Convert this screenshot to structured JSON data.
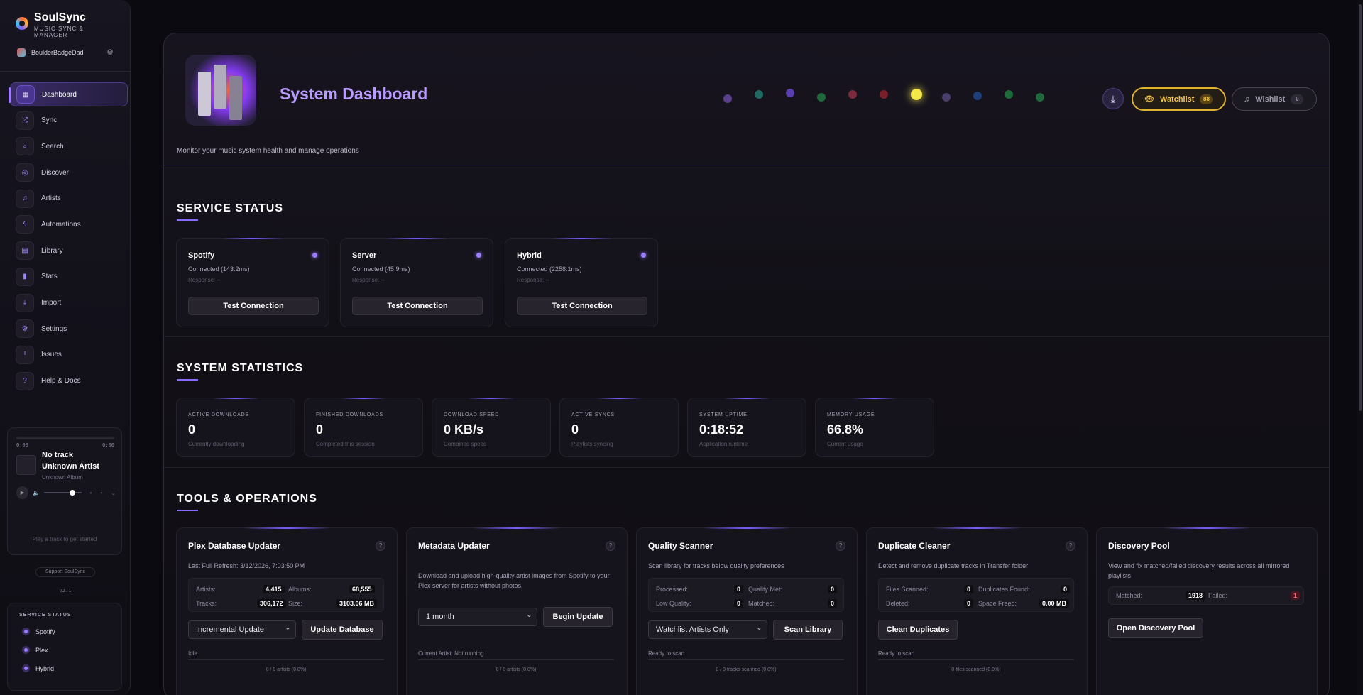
{
  "app": {
    "name": "SoulSync",
    "subtitle": "MUSIC SYNC & MANAGER",
    "user": "BoulderBadgeDad"
  },
  "nav": [
    {
      "label": "Dashboard",
      "icon": "grid-icon",
      "active": true
    },
    {
      "label": "Sync",
      "icon": "shuffle-icon"
    },
    {
      "label": "Search",
      "icon": "search-icon"
    },
    {
      "label": "Discover",
      "icon": "compass-icon"
    },
    {
      "label": "Artists",
      "icon": "music-note-icon"
    },
    {
      "label": "Automations",
      "icon": "bolt-icon"
    },
    {
      "label": "Library",
      "icon": "book-icon"
    },
    {
      "label": "Stats",
      "icon": "bar-chart-icon"
    },
    {
      "label": "Import",
      "icon": "import-icon"
    },
    {
      "label": "Settings",
      "icon": "gear-icon"
    },
    {
      "label": "Issues",
      "icon": "alert-icon"
    },
    {
      "label": "Help & Docs",
      "icon": "help-icon"
    }
  ],
  "player": {
    "time_start": "0:00",
    "time_end": "0:00",
    "title": "No track",
    "artist": "Unknown Artist",
    "album": "Unknown Album",
    "hint": "Play a track to get started"
  },
  "support": "Support SoulSync",
  "version": "v2.1",
  "sidebar_status": {
    "title": "SERVICE STATUS",
    "items": [
      "Spotify",
      "Plex",
      "Hybrid"
    ]
  },
  "header": {
    "title": "System Dashboard",
    "subtitle": "Monitor your music system health and manage operations",
    "watchlist_label": "Watchlist",
    "watchlist_count": "88",
    "wishlist_label": "Wishlist",
    "wishlist_count": "0"
  },
  "led_colors": [
    "#5a3f8c",
    "#1f6b63",
    "#5a3fb0",
    "#1f6a3a",
    "#7a2a3a",
    "#7a1f2a",
    "#f2e84a",
    "#4a3f6a",
    "#1f3f7a",
    "#1f6a3a",
    "#1f6a3a"
  ],
  "service_status": {
    "title": "SERVICE STATUS",
    "cards": [
      {
        "name": "Spotify",
        "connection": "Connected (143.2ms)",
        "response": "Response: --",
        "button": "Test Connection"
      },
      {
        "name": "Server",
        "connection": "Connected (45.9ms)",
        "response": "Response: --",
        "button": "Test Connection"
      },
      {
        "name": "Hybrid",
        "connection": "Connected (2258.1ms)",
        "response": "Response: --",
        "button": "Test Connection"
      }
    ]
  },
  "system_statistics": {
    "title": "SYSTEM STATISTICS",
    "cards": [
      {
        "label": "ACTIVE DOWNLOADS",
        "value": "0",
        "sub": "Currently downloading"
      },
      {
        "label": "FINISHED DOWNLOADS",
        "value": "0",
        "sub": "Completed this session"
      },
      {
        "label": "DOWNLOAD SPEED",
        "value": "0 KB/s",
        "sub": "Combined speed"
      },
      {
        "label": "ACTIVE SYNCS",
        "value": "0",
        "sub": "Playlists syncing"
      },
      {
        "label": "SYSTEM UPTIME",
        "value": "0:18:52",
        "sub": "Application runtime"
      },
      {
        "label": "MEMORY USAGE",
        "value": "66.8%",
        "sub": "Current usage"
      }
    ]
  },
  "tools": {
    "title": "TOOLS & OPERATIONS",
    "plex": {
      "title": "Plex Database Updater",
      "desc": "Last Full Refresh: 3/12/2026, 7:03:50 PM",
      "artists_label": "Artists:",
      "artists": "4,415",
      "albums_label": "Albums:",
      "albums": "68,555",
      "tracks_label": "Tracks:",
      "tracks": "306,172",
      "size_label": "Size:",
      "size": "3103.06 MB",
      "select": "Incremental Update",
      "button": "Update Database",
      "status": "Idle",
      "progress": "0 / 0 artists (0.0%)"
    },
    "metadata": {
      "title": "Metadata Updater",
      "desc": "Download and upload high-quality artist images from Spotify to your Plex server for artists without photos.",
      "select": "1 month",
      "button": "Begin Update",
      "status": "Current Artist: Not running",
      "progress": "0 / 0 artists (0.0%)"
    },
    "quality": {
      "title": "Quality Scanner",
      "desc": "Scan library for tracks below quality preferences",
      "processed_label": "Processed:",
      "processed": "0",
      "met_label": "Quality Met:",
      "met": "0",
      "low_label": "Low Quality:",
      "low": "0",
      "matched_label": "Matched:",
      "matched": "0",
      "select": "Watchlist Artists Only",
      "button": "Scan Library",
      "status": "Ready to scan",
      "progress": "0 / 0 tracks scanned (0.0%)"
    },
    "duplicate": {
      "title": "Duplicate Cleaner",
      "desc": "Detect and remove duplicate tracks in Transfer folder",
      "scanned_label": "Files Scanned:",
      "scanned": "0",
      "found_label": "Duplicates Found:",
      "found": "0",
      "deleted_label": "Deleted:",
      "deleted": "0",
      "freed_label": "Space Freed:",
      "freed": "0.00 MB",
      "button": "Clean Duplicates",
      "status": "Ready to scan",
      "progress": "0 files scanned (0.0%)"
    },
    "discovery": {
      "title": "Discovery Pool",
      "desc": "View and fix matched/failed discovery results across all mirrored playlists",
      "matched_label": "Matched:",
      "matched": "1918",
      "failed_label": "Failed:",
      "failed": "1",
      "button": "Open Discovery Pool"
    }
  }
}
